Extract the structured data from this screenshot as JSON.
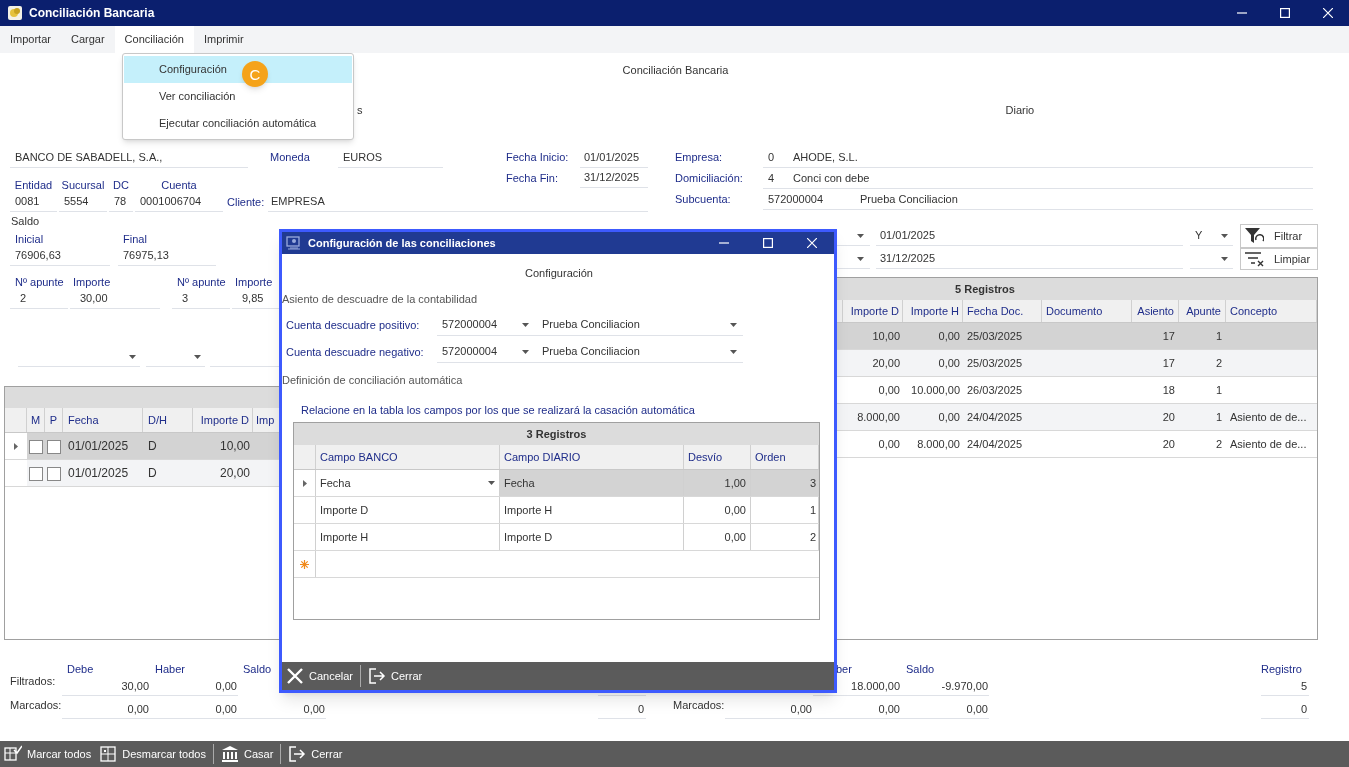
{
  "window": {
    "title": "Conciliación Bancaria"
  },
  "menu": [
    {
      "label": "Importar",
      "selected": false
    },
    {
      "label": "Cargar",
      "selected": false
    },
    {
      "label": "Conciliación",
      "selected": true
    },
    {
      "label": "Imprimir",
      "selected": false
    }
  ],
  "menu_dropdown": {
    "items": [
      {
        "label": "Configuración",
        "highlighted": true
      },
      {
        "label": "Ver conciliación",
        "highlighted": false
      },
      {
        "label": "Ejecutar conciliación automática",
        "highlighted": false
      }
    ],
    "badge": "C"
  },
  "heading": "Conciliación Bancaria",
  "partial_label": "s",
  "diary_label": "Diario",
  "bank": {
    "name": "BANCO DE SABADELL, S.A.,",
    "currency_label": "Moneda",
    "currency": "EUROS",
    "fields": [
      {
        "label": "Entidad",
        "value": "0081"
      },
      {
        "label": "Sucursal",
        "value": "5554"
      },
      {
        "label": "DC",
        "value": "78"
      },
      {
        "label": "Cuenta",
        "value": "0001006704"
      }
    ],
    "client_label": "Cliente:",
    "client": "EMPRESA"
  },
  "dates": [
    {
      "label": "Fecha Inicio:",
      "value": "01/01/2025"
    },
    {
      "label": "Fecha Fin:",
      "value": "31/12/2025"
    }
  ],
  "company": [
    {
      "label": "Empresa:",
      "code": "0",
      "value": "AHODE, S.L."
    },
    {
      "label": "Domiciliación:",
      "code": "4",
      "value": "Conci con debe"
    },
    {
      "label": "Subcuenta:",
      "code": "572000004",
      "value": "Prueba Conciliacion"
    }
  ],
  "saldo": {
    "label": "Saldo",
    "items": [
      {
        "label": "Inicial",
        "value": "76906,63"
      },
      {
        "label": "Final",
        "value": "76975,13"
      }
    ]
  },
  "apuntes": [
    {
      "number_label": "Nº apunte",
      "number": "2",
      "amount_label": "Importe",
      "amount": "30,00"
    },
    {
      "number_label": "Nº apunte",
      "number": "3",
      "amount_label": "Importe",
      "amount": "9,85"
    }
  ],
  "filter": {
    "rows": [
      {
        "date": "01/01/2025",
        "operator": "Y"
      },
      {
        "date": "31/12/2025",
        "operator": ""
      }
    ],
    "buttons": [
      {
        "label": "Filtrar",
        "kind": "filter"
      },
      {
        "label": "Limpiar",
        "kind": "clear"
      }
    ]
  },
  "bank_grid": {
    "check_columns": [
      "M",
      "P"
    ],
    "columns": [
      "Fecha",
      "D/H",
      "Importe D",
      "Imp"
    ],
    "rows": [
      {
        "selected": true,
        "marked": false,
        "p": false,
        "cells": [
          "01/01/2025",
          "D",
          "10,00"
        ]
      },
      {
        "selected": false,
        "marked": false,
        "p": false,
        "cells": [
          "01/01/2025",
          "D",
          "20,00"
        ]
      }
    ]
  },
  "diary_grid": {
    "caption": "5 Registros",
    "columns": [
      "Importe D",
      "Importe H",
      "Fecha Doc.",
      "Documento",
      "Asiento",
      "Apunte",
      "Concepto"
    ],
    "rows": [
      {
        "selected": true,
        "cells": [
          "10,00",
          "0,00",
          "25/03/2025",
          "",
          "17",
          "1",
          ""
        ]
      },
      {
        "selected": false,
        "cells": [
          "20,00",
          "0,00",
          "25/03/2025",
          "",
          "17",
          "2",
          ""
        ]
      },
      {
        "selected": false,
        "cells": [
          "0,00",
          "10.000,00",
          "26/03/2025",
          "",
          "18",
          "1",
          ""
        ]
      },
      {
        "selected": false,
        "cells": [
          "8.000,00",
          "0,00",
          "24/04/2025",
          "",
          "20",
          "1",
          "Asiento de de..."
        ]
      },
      {
        "selected": false,
        "cells": [
          "0,00",
          "8.000,00",
          "24/04/2025",
          "",
          "20",
          "2",
          "Asiento de de..."
        ]
      }
    ]
  },
  "bank_totals": {
    "filtered_label": "Filtrados:",
    "marked_label": "Marcados:",
    "columns": [
      {
        "heading": "Debe",
        "filtered": "30,00",
        "marked": "0,00"
      },
      {
        "heading": "Haber",
        "filtered": "0,00",
        "marked": "0,00"
      },
      {
        "heading": "Saldo",
        "marked": "0,00"
      }
    ],
    "count": "0"
  },
  "diary_totals": {
    "marked_label": "Marcados:",
    "columns": [
      {
        "marked": "0,00"
      },
      {
        "heading": "ber",
        "filtered": "18.000,00",
        "marked": "0,00"
      },
      {
        "heading": "Saldo",
        "filtered": "-9.970,00",
        "marked": "0,00"
      }
    ],
    "count_label": "Registro",
    "counts": [
      "5",
      "0"
    ]
  },
  "toolbar": [
    {
      "label": "Marcar todos",
      "kind": "check_all"
    },
    {
      "label": "Desmarcar todos",
      "kind": "uncheck_all"
    },
    {
      "label": "Casar",
      "kind": "match"
    },
    {
      "label": "Cerrar",
      "kind": "exit"
    }
  ],
  "dialog": {
    "title": "Configuración de las conciliaciones",
    "heading": "Configuración",
    "section_1": "Asiento de descuadre de la contabilidad",
    "accounts": [
      {
        "label": "Cuenta descuadre positivo:",
        "code": "572000004",
        "name": "Prueba Conciliacion"
      },
      {
        "label": "Cuenta descuadre negativo:",
        "code": "572000004",
        "name": "Prueba Conciliacion"
      }
    ],
    "section_2": "Definición de conciliación automática",
    "hint": "Relacione en la tabla los campos por los que se realizará la casación automática",
    "grid": {
      "caption": "3 Registros",
      "columns": [
        "Campo BANCO",
        "Campo DIARIO",
        "Desvío",
        "Orden"
      ],
      "rows": [
        {
          "selected": true,
          "cells": [
            "Fecha",
            "Fecha",
            "1,00",
            "3"
          ]
        },
        {
          "selected": false,
          "cells": [
            "Importe D",
            "Importe H",
            "0,00",
            "1"
          ]
        },
        {
          "selected": false,
          "cells": [
            "Importe H",
            "Importe D",
            "0,00",
            "2"
          ]
        }
      ]
    },
    "buttons": [
      {
        "label": "Cancelar",
        "kind": "cancel"
      },
      {
        "label": "Cerrar",
        "kind": "exit"
      }
    ]
  }
}
